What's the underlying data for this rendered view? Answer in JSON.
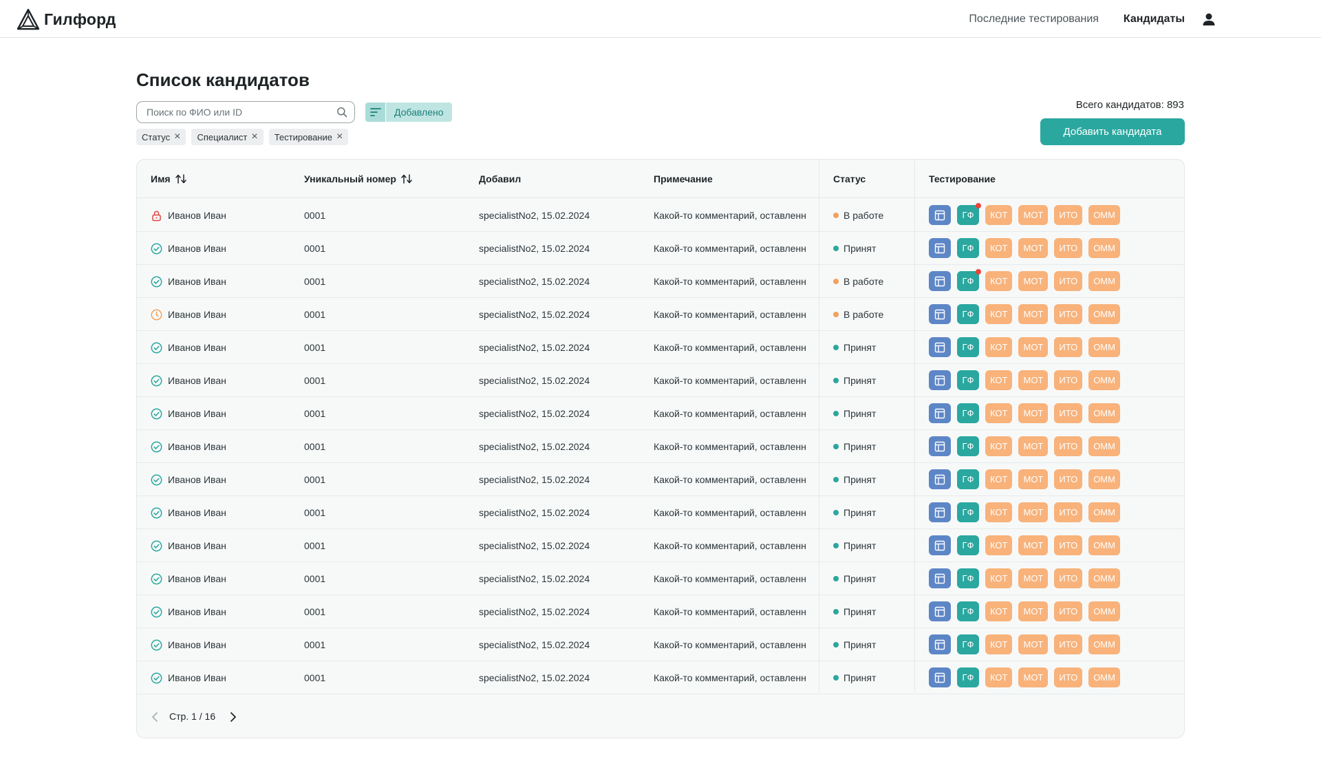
{
  "header": {
    "logo_text": "Гилфорд",
    "nav": [
      {
        "label": "Последние тестирования",
        "active": false
      },
      {
        "label": "Кандидаты",
        "active": true
      }
    ]
  },
  "page": {
    "title": "Список кандидатов",
    "search_placeholder": "Поиск по ФИО или ID",
    "sort_label": "Добавлено",
    "filters": [
      "Статус",
      "Специалист",
      "Тестирование"
    ],
    "total_label": "Всего кандидатов: 893",
    "add_button": "Добавить кандидата"
  },
  "table": {
    "columns": [
      "Имя",
      "Уникальный номер",
      "Добавил",
      "Примечание",
      "Статус",
      "Тестирование"
    ],
    "tests": [
      "ГФ",
      "КОТ",
      "МОТ",
      "ИТО",
      "ОММ"
    ],
    "rows": [
      {
        "icon": "lock",
        "name": "Иванов Иван",
        "id": "0001",
        "added_by": "specialistNo2, 15.02.2024",
        "note": "Какой-то комментарий, оставленн",
        "status": "В работе",
        "status_kind": "work",
        "notify": true
      },
      {
        "icon": "check",
        "name": "Иванов Иван",
        "id": "0001",
        "added_by": "specialistNo2, 15.02.2024",
        "note": "Какой-то комментарий, оставленн",
        "status": "Принят",
        "status_kind": "ok",
        "notify": false
      },
      {
        "icon": "check",
        "name": "Иванов Иван",
        "id": "0001",
        "added_by": "specialistNo2, 15.02.2024",
        "note": "Какой-то комментарий, оставленн",
        "status": "В работе",
        "status_kind": "work",
        "notify": true
      },
      {
        "icon": "clock",
        "name": "Иванов Иван",
        "id": "0001",
        "added_by": "specialistNo2, 15.02.2024",
        "note": "Какой-то комментарий, оставленн",
        "status": "В работе",
        "status_kind": "work",
        "notify": false
      },
      {
        "icon": "check",
        "name": "Иванов Иван",
        "id": "0001",
        "added_by": "specialistNo2, 15.02.2024",
        "note": "Какой-то комментарий, оставленн",
        "status": "Принят",
        "status_kind": "ok",
        "notify": false
      },
      {
        "icon": "check",
        "name": "Иванов Иван",
        "id": "0001",
        "added_by": "specialistNo2, 15.02.2024",
        "note": "Какой-то комментарий, оставленн",
        "status": "Принят",
        "status_kind": "ok",
        "notify": false
      },
      {
        "icon": "check",
        "name": "Иванов Иван",
        "id": "0001",
        "added_by": "specialistNo2, 15.02.2024",
        "note": "Какой-то комментарий, оставленн",
        "status": "Принят",
        "status_kind": "ok",
        "notify": false
      },
      {
        "icon": "check",
        "name": "Иванов Иван",
        "id": "0001",
        "added_by": "specialistNo2, 15.02.2024",
        "note": "Какой-то комментарий, оставленн",
        "status": "Принят",
        "status_kind": "ok",
        "notify": false
      },
      {
        "icon": "check",
        "name": "Иванов Иван",
        "id": "0001",
        "added_by": "specialistNo2, 15.02.2024",
        "note": "Какой-то комментарий, оставленн",
        "status": "Принят",
        "status_kind": "ok",
        "notify": false
      },
      {
        "icon": "check",
        "name": "Иванов Иван",
        "id": "0001",
        "added_by": "specialistNo2, 15.02.2024",
        "note": "Какой-то комментарий, оставленн",
        "status": "Принят",
        "status_kind": "ok",
        "notify": false
      },
      {
        "icon": "check",
        "name": "Иванов Иван",
        "id": "0001",
        "added_by": "specialistNo2, 15.02.2024",
        "note": "Какой-то комментарий, оставленн",
        "status": "Принят",
        "status_kind": "ok",
        "notify": false
      },
      {
        "icon": "check",
        "name": "Иванов Иван",
        "id": "0001",
        "added_by": "specialistNo2, 15.02.2024",
        "note": "Какой-то комментарий, оставленн",
        "status": "Принят",
        "status_kind": "ok",
        "notify": false
      },
      {
        "icon": "check",
        "name": "Иванов Иван",
        "id": "0001",
        "added_by": "specialistNo2, 15.02.2024",
        "note": "Какой-то комментарий, оставленн",
        "status": "Принят",
        "status_kind": "ok",
        "notify": false
      },
      {
        "icon": "check",
        "name": "Иванов Иван",
        "id": "0001",
        "added_by": "specialistNo2, 15.02.2024",
        "note": "Какой-то комментарий, оставленн",
        "status": "Принят",
        "status_kind": "ok",
        "notify": false
      },
      {
        "icon": "check",
        "name": "Иванов Иван",
        "id": "0001",
        "added_by": "specialistNo2, 15.02.2024",
        "note": "Какой-то комментарий, оставленн",
        "status": "Принят",
        "status_kind": "ok",
        "notify": false
      }
    ]
  },
  "pagination": {
    "label": "Стр. 1 / 16"
  },
  "colors": {
    "accent": "#2aa79f",
    "doc_button": "#5d86c6",
    "test_orange": "#f8b27a",
    "status_ok": "#2aa79f",
    "status_work": "#f3a15c",
    "lock_red": "#e0443f",
    "notify_red": "#e8453c"
  },
  "icons": {
    "logo": "logo-triangle-icon",
    "user": "user-icon",
    "search": "search-icon",
    "sort": "sort-lines-icon",
    "filter_remove": "close-icon",
    "column_sort": "sort-arrows-icon",
    "row_status": [
      "lock-icon",
      "check-circle-icon",
      "clock-icon"
    ],
    "test_doc": "table-doc-icon",
    "prev": "chevron-left-icon",
    "next": "chevron-right-icon"
  }
}
